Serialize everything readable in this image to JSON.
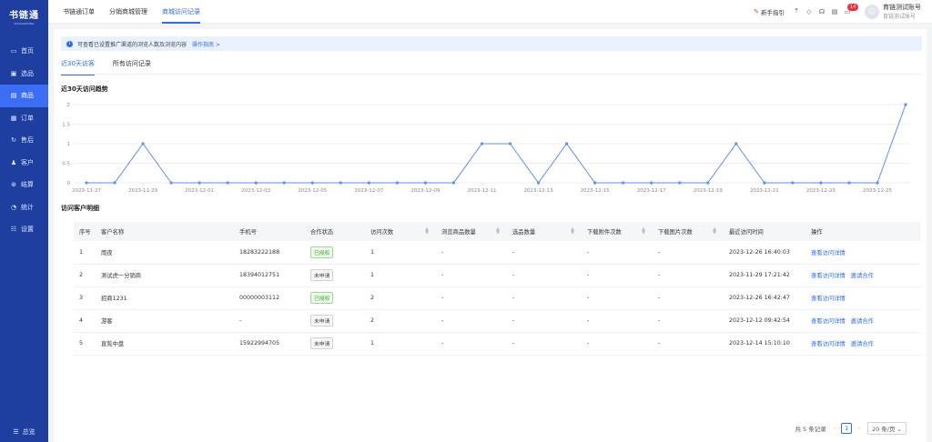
{
  "app": {
    "logo_title": "书链通",
    "logo_sub": "SHULIANTONG"
  },
  "sidebar": {
    "items": [
      {
        "label": "首页",
        "icon": "▭"
      },
      {
        "label": "选品",
        "icon": "▣"
      },
      {
        "label": "商品",
        "icon": "▤",
        "active": true
      },
      {
        "label": "订单",
        "icon": "▦"
      },
      {
        "label": "售后",
        "icon": "↻"
      },
      {
        "label": "客户",
        "icon": "♟"
      },
      {
        "label": "结算",
        "icon": "⊛"
      },
      {
        "label": "统计",
        "icon": "◔"
      },
      {
        "label": "设置",
        "icon": "☷"
      }
    ],
    "footer": "总览"
  },
  "topnav": {
    "tabs": [
      {
        "label": "书链通订单"
      },
      {
        "label": "分销商城管理"
      },
      {
        "label": "商城访问记录",
        "active": true
      }
    ]
  },
  "topright": {
    "guide": "新手指引",
    "badge": "14",
    "user_name": "育链测试账号",
    "user_role": "育链测试账号"
  },
  "notice": {
    "text": "可查看已设置推广渠道的浏览人数及浏览内容",
    "link": "操作指南 >"
  },
  "subtabs": [
    {
      "label": "近30天访客",
      "active": true
    },
    {
      "label": "所有访问记录"
    }
  ],
  "trend_title": "近30天访问趋势",
  "detail_title": "访问客户明细",
  "chart_data": {
    "type": "line",
    "x": [
      "2023-11-27",
      "2023-11-28",
      "2023-11-29",
      "2023-11-30",
      "2023-12-01",
      "2023-12-02",
      "2023-12-03",
      "2023-12-04",
      "2023-12-05",
      "2023-12-06",
      "2023-12-07",
      "2023-12-08",
      "2023-12-09",
      "2023-12-10",
      "2023-12-11",
      "2023-12-12",
      "2023-12-13",
      "2023-12-14",
      "2023-12-15",
      "2023-12-16",
      "2023-12-17",
      "2023-12-18",
      "2023-12-19",
      "2023-12-20",
      "2023-12-21",
      "2023-12-22",
      "2023-12-23",
      "2023-12-24",
      "2023-12-25",
      "2023-12-26"
    ],
    "xticks": [
      "2023-11-27",
      "2023-11-29",
      "2023-12-01",
      "2023-12-03",
      "2023-12-05",
      "2023-12-07",
      "2023-12-09",
      "2023-12-11",
      "2023-12-13",
      "2023-12-15",
      "2023-12-17",
      "2023-12-19",
      "2023-12-21",
      "2023-12-23",
      "2023-12-25"
    ],
    "values": [
      0,
      0,
      1,
      0,
      0,
      0,
      0,
      0,
      0,
      0,
      0,
      0,
      0,
      0,
      1,
      1,
      0,
      1,
      0,
      0,
      0,
      0,
      0,
      1,
      0,
      0,
      0,
      0,
      0,
      2
    ],
    "yticks": [
      "0",
      "0.5",
      "1",
      "1.5",
      "2"
    ],
    "ylim": [
      0,
      2
    ],
    "grid": true,
    "color": "#5b8ff9"
  },
  "table": {
    "columns": [
      "序号",
      "客户名称",
      "手机号",
      "合作状态",
      "访问次数",
      "浏览商品数量",
      "选品数量",
      "下载附件次数",
      "下载图片次数",
      "最近访问时间",
      "操作"
    ],
    "rows": [
      {
        "no": "1",
        "name": "雨夜",
        "phone": "18283222188",
        "status": "已授权",
        "status_type": "ok",
        "visits": "1",
        "browse": "-",
        "select": "-",
        "dl_att": "-",
        "dl_img": "-",
        "last": "2023-12-26 16:40:03",
        "ops": [
          "查看访问详情"
        ]
      },
      {
        "no": "2",
        "name": "测试虎一分销商",
        "phone": "18394012751",
        "status": "未申请",
        "status_type": "no",
        "visits": "1",
        "browse": "-",
        "select": "-",
        "dl_att": "-",
        "dl_img": "-",
        "last": "2023-11-29 17:21:42",
        "ops": [
          "查看访问详情",
          "邀请合作"
        ]
      },
      {
        "no": "3",
        "name": "招商1231",
        "phone": "00000003112",
        "status": "已授权",
        "status_type": "ok",
        "visits": "2",
        "browse": "-",
        "select": "-",
        "dl_att": "-",
        "dl_img": "-",
        "last": "2023-12-26 16:42:47",
        "ops": [
          "查看访问详情"
        ]
      },
      {
        "no": "4",
        "name": "游客",
        "phone": "-",
        "status": "未申请",
        "status_type": "no",
        "visits": "2",
        "browse": "-",
        "select": "-",
        "dl_att": "-",
        "dl_img": "-",
        "last": "2023-12-12 09:42:54",
        "ops": [
          "查看访问详情",
          "邀请合作"
        ]
      },
      {
        "no": "5",
        "name": "直覧中盘",
        "phone": "15922994705",
        "status": "未申请",
        "status_type": "no",
        "visits": "1",
        "browse": "-",
        "select": "-",
        "dl_att": "-",
        "dl_img": "-",
        "last": "2023-12-14 15:10:10",
        "ops": [
          "查看访问详情",
          "邀请合作"
        ]
      }
    ]
  },
  "pager": {
    "total": "共 5 条记录",
    "page": "1",
    "size": "20 条/页"
  }
}
